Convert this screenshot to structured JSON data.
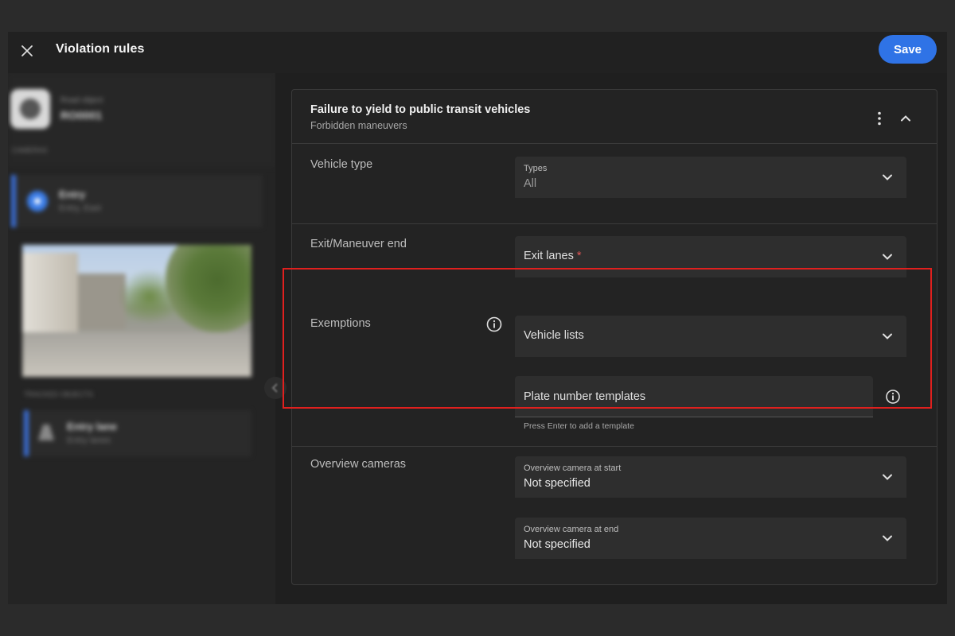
{
  "header": {
    "title": "Violation rules",
    "save_label": "Save"
  },
  "sidebar": {
    "object_caption": "Road object",
    "object_id": "RO0001",
    "section_cameras": "CAMERAS",
    "camera": {
      "title": "Entry",
      "subtitle": "Entry, East"
    },
    "section_tracked": "TRACKED OBJECTS",
    "lane": {
      "title": "Entry lane",
      "subtitle": "Entry lanes"
    }
  },
  "rule": {
    "title": "Failure to yield to public transit vehicles",
    "subtitle": "Forbidden maneuvers",
    "vehicle_type": {
      "label": "Vehicle type",
      "field_label": "Types",
      "value": "All"
    },
    "exit": {
      "label": "Exit/Maneuver end",
      "placeholder": "Exit lanes",
      "required_mark": "*"
    },
    "exemptions": {
      "label": "Exemptions",
      "vehicle_lists_placeholder": "Vehicle lists",
      "plate_placeholder": "Plate number templates",
      "plate_helper": "Press Enter to add a template"
    },
    "overview": {
      "label": "Overview cameras",
      "start_label": "Overview camera at start",
      "start_value": "Not specified",
      "end_label": "Overview camera at end",
      "end_value": "Not specified"
    }
  },
  "icons": {
    "close": "close-icon",
    "more": "more-vert-icon",
    "collapse": "chevron-up-icon",
    "dropdown": "chevron-down-icon",
    "info": "info-icon",
    "panel_toggle": "chevron-left-icon"
  },
  "colors": {
    "accent": "#2f73e6",
    "highlight": "#e0201e",
    "required": "#e05555"
  }
}
